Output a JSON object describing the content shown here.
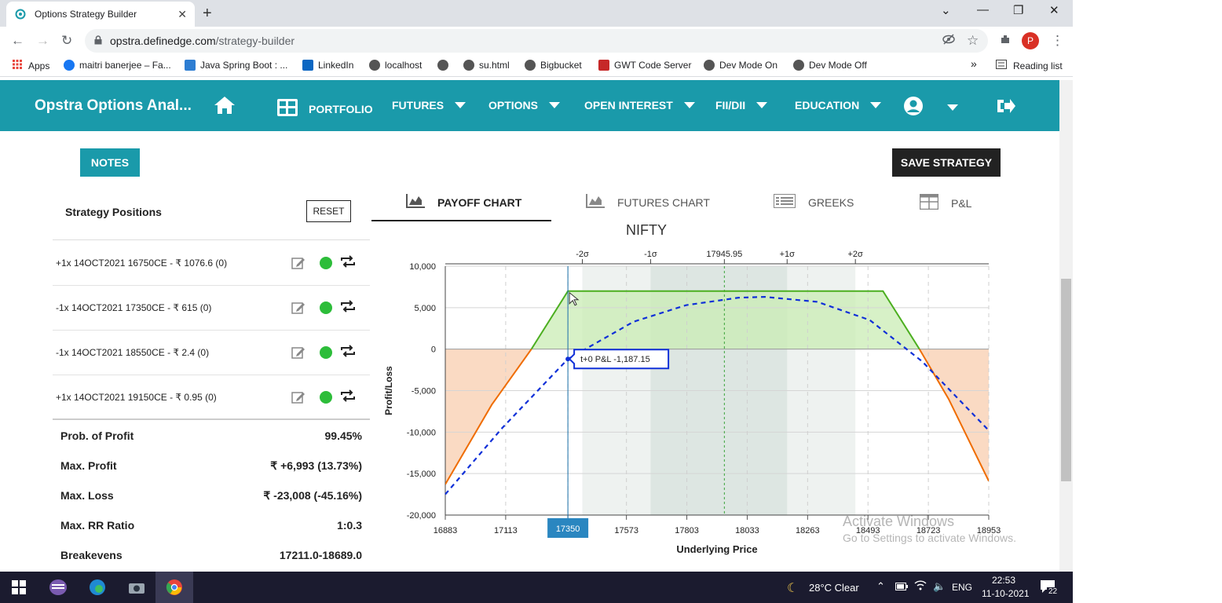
{
  "browser": {
    "tab_title": "Options Strategy Builder",
    "url_host": "opstra.definedge.com",
    "url_path": "/strategy-builder",
    "profile_initial": "P",
    "bookmarks": [
      "Apps",
      "maitri banerjee – Fa...",
      "Java Spring Boot : ...",
      "LinkedIn",
      "localhost",
      "",
      "su.html",
      "Bigbucket",
      "GWT Code Server",
      "Dev Mode On",
      "Dev Mode Off"
    ],
    "reading_list": "Reading list",
    "more": "»"
  },
  "site": {
    "brand": "Opstra Options Anal...",
    "nav": [
      "PORTFOLIO",
      "FUTURES",
      "OPTIONS",
      "OPEN INTEREST",
      "FII/DII",
      "EDUCATION"
    ],
    "accent_color": "#1a9aaa"
  },
  "actions": {
    "notes": "NOTES",
    "save": "SAVE STRATEGY",
    "reset": "RESET"
  },
  "positions": {
    "title": "Strategy Positions",
    "rows": [
      "+1x  14OCT2021  16750CE  - ₹ 1076.6   (0)",
      "-1x  14OCT2021  17350CE  - ₹ 615   (0)",
      "-1x  14OCT2021  18550CE  - ₹ 2.4   (0)",
      "+1x  14OCT2021  19150CE  - ₹ 0.95   (0)"
    ]
  },
  "stats": [
    {
      "label": "Prob. of Profit",
      "value": "99.45%"
    },
    {
      "label": "Max. Profit",
      "value": "₹ +6,993 (13.73%)"
    },
    {
      "label": "Max. Loss",
      "value": "₹ -23,008 (-45.16%)"
    },
    {
      "label": "Max. RR Ratio",
      "value": "1:0.3"
    },
    {
      "label": "Breakevens",
      "value": "17211.0-18689.0"
    }
  ],
  "chart_tabs": [
    "PAYOFF CHART",
    "FUTURES CHART",
    "GREEKS",
    "P&L"
  ],
  "chart_data": {
    "type": "line",
    "title": "NIFTY",
    "xlabel": "Underlying Price",
    "ylabel": "Profit/Loss",
    "xlim": [
      16883,
      18953
    ],
    "ylim": [
      -20000,
      10000
    ],
    "x_ticks": [
      "16883",
      "17113",
      "17350",
      "17573",
      "17803",
      "18033",
      "18263",
      "18493",
      "18723",
      "18953"
    ],
    "y_ticks": [
      "10,000",
      "5,000",
      "0",
      "-5,000",
      "-10,000",
      "-15,000",
      "-20,000"
    ],
    "sigma_labels": [
      "-2σ",
      "-1σ",
      "17945.95",
      "+1σ",
      "+2σ"
    ],
    "sigma_values": [
      17405,
      17665,
      17945.95,
      18185,
      18445
    ],
    "series": [
      {
        "color": "#4caf20",
        "x": [
          16883,
          16953,
          17060,
          17211,
          17350,
          18550,
          18689,
          18800,
          18953
        ],
        "y": [
          -16300,
          -12500,
          -6700,
          0,
          6993,
          6993,
          0,
          -6000,
          -15900
        ]
      },
      {
        "style": "dashed",
        "color": "#1030d8",
        "x": [
          16883,
          17100,
          17350,
          17600,
          17800,
          18000,
          18100,
          18300,
          18500,
          18700,
          18953
        ],
        "y": [
          -17500,
          -9500,
          -1187.15,
          3300,
          5300,
          6200,
          6300,
          5700,
          3500,
          -1500,
          -9800
        ]
      }
    ],
    "cursor_x": 17350,
    "cursor_x_label": "17350",
    "tooltip": "t+0 P&L -1,187.15",
    "profit_color": "#c9ecb4",
    "loss_color": "#f9d6bd"
  },
  "watermark": [
    "Activate Windows",
    "Go to Settings to activate Windows."
  ],
  "taskbar": {
    "weather": "28°C  Clear",
    "lang": "ENG",
    "time": "22:53",
    "date": "11-10-2021",
    "notifications": "22"
  }
}
